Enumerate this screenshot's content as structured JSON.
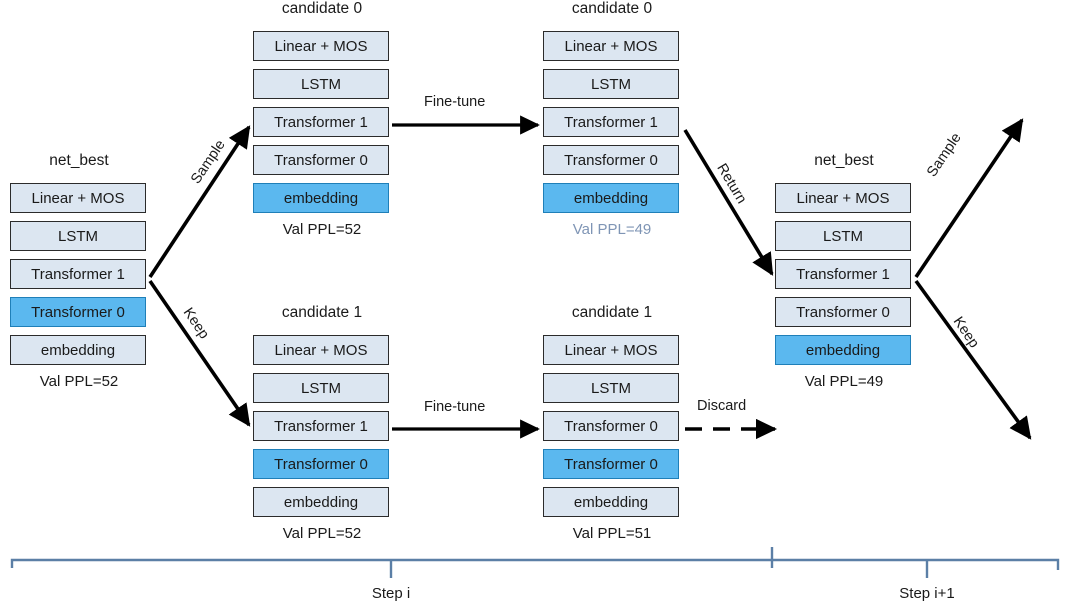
{
  "colors": {
    "layer_fill": "#dce6f1",
    "layer_highlight": "#5bb8ef",
    "layer_border": "#2b2b2b",
    "bracket": "#5b7fa6",
    "muted_text": "#7f95b5",
    "arrow": "#000000",
    "background": "#ffffff"
  },
  "stacks": [
    {
      "id": "net-best-left",
      "title": "net_best",
      "caption": "Val PPL=52",
      "caption_muted": false,
      "layers": [
        {
          "label": "Linear + MOS",
          "highlight": false
        },
        {
          "label": "LSTM",
          "highlight": false
        },
        {
          "label": "Transformer 1",
          "highlight": false
        },
        {
          "label": "Transformer 0",
          "highlight": true
        },
        {
          "label": "embedding",
          "highlight": false
        }
      ]
    },
    {
      "id": "candidate-0-before",
      "title": "candidate 0",
      "caption": "Val PPL=52",
      "caption_muted": false,
      "layers": [
        {
          "label": "Linear + MOS",
          "highlight": false
        },
        {
          "label": "LSTM",
          "highlight": false
        },
        {
          "label": "Transformer 1",
          "highlight": false
        },
        {
          "label": "Transformer 0",
          "highlight": false
        },
        {
          "label": "embedding",
          "highlight": true
        }
      ]
    },
    {
      "id": "candidate-0-after",
      "title": "candidate 0",
      "caption": "Val PPL=49",
      "caption_muted": true,
      "layers": [
        {
          "label": "Linear + MOS",
          "highlight": false
        },
        {
          "label": "LSTM",
          "highlight": false
        },
        {
          "label": "Transformer 1",
          "highlight": false
        },
        {
          "label": "Transformer 0",
          "highlight": false
        },
        {
          "label": "embedding",
          "highlight": true
        }
      ]
    },
    {
      "id": "candidate-1-before",
      "title": "candidate 1",
      "caption": "Val PPL=52",
      "caption_muted": false,
      "layers": [
        {
          "label": "Linear + MOS",
          "highlight": false
        },
        {
          "label": "LSTM",
          "highlight": false
        },
        {
          "label": "Transformer 1",
          "highlight": false
        },
        {
          "label": "Transformer 0",
          "highlight": true
        },
        {
          "label": "embedding",
          "highlight": false
        }
      ]
    },
    {
      "id": "candidate-1-after",
      "title": "candidate 1",
      "caption": "Val PPL=51",
      "caption_muted": false,
      "layers": [
        {
          "label": "Linear + MOS",
          "highlight": false
        },
        {
          "label": "LSTM",
          "highlight": false
        },
        {
          "label": "Transformer 0",
          "highlight": false
        },
        {
          "label": "Transformer 0",
          "highlight": true
        },
        {
          "label": "embedding",
          "highlight": false
        }
      ]
    },
    {
      "id": "net-best-right",
      "title": "net_best",
      "caption": "Val PPL=49",
      "caption_muted": false,
      "layers": [
        {
          "label": "Linear + MOS",
          "highlight": false
        },
        {
          "label": "LSTM",
          "highlight": false
        },
        {
          "label": "Transformer 1",
          "highlight": false
        },
        {
          "label": "Transformer 0",
          "highlight": false
        },
        {
          "label": "embedding",
          "highlight": true
        }
      ]
    }
  ],
  "arrow_labels": {
    "sample_left": "Sample",
    "keep_left": "Keep",
    "fine_tune_top": "Fine-tune",
    "fine_tune_bottom": "Fine-tune",
    "return": "Return",
    "discard": "Discard",
    "sample_right": "Sample",
    "keep_right": "Keep"
  },
  "timeline": {
    "step_current": "Step i",
    "step_next": "Step i+1"
  }
}
